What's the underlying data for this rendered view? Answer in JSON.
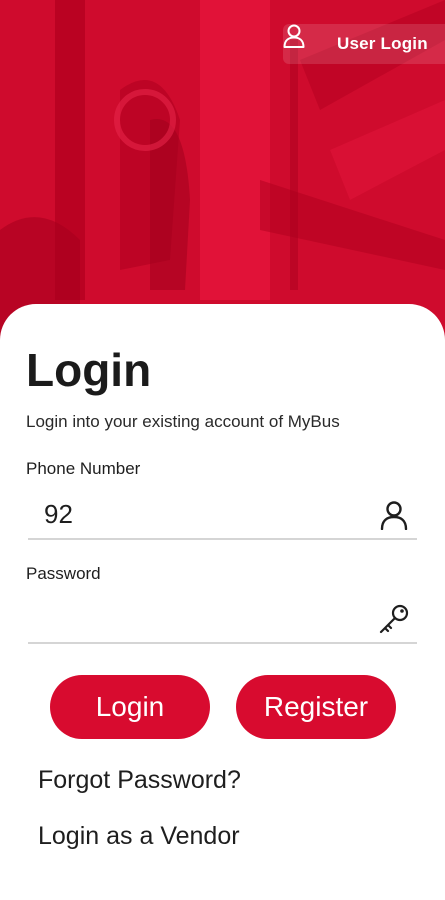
{
  "header": {
    "user_login_label": "User Login",
    "user_icon": "user-icon"
  },
  "login": {
    "title": "Login",
    "subtitle": "Login into your existing account of MyBus",
    "phone": {
      "label": "Phone Number",
      "value": "92",
      "icon": "user-icon"
    },
    "password": {
      "label": "Password",
      "value": "",
      "icon": "key-icon"
    },
    "login_button": "Login",
    "register_button": "Register",
    "forgot_password": "Forgot Password?",
    "vendor_login": "Login as a Vendor"
  },
  "colors": {
    "brand_red": "#d80b2f",
    "hero_red": "#cf0b2d"
  }
}
